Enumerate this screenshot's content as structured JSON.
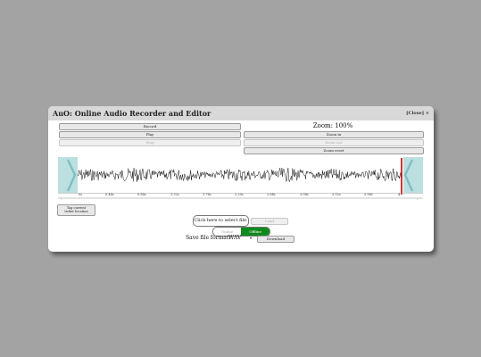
{
  "dialog": {
    "title": "AuO: Online Audio Recorder and Editor",
    "close_label": "[Close] ×"
  },
  "controls": {
    "record": "Record",
    "play": "Play",
    "stop": "Stop",
    "zoom_label": "Zoom: 100%",
    "zoom_in": "Zoom in",
    "zoom_out": "Zoom out",
    "zoom_reset": "Zoom reset"
  },
  "timeline": {
    "ticks": [
      "0s",
      "0.44s",
      "0.88s",
      "1.32s",
      "1.76s",
      "2.20s",
      "2.64s",
      "3.08s",
      "3.52s",
      "3.96s",
      "4"
    ],
    "scroll_left": "‹",
    "scroll_right": "›"
  },
  "tag_button": {
    "line1": "Tag current",
    "line2": "ticker location"
  },
  "file": {
    "select_label": "Click here to select file.",
    "load_label": "Load"
  },
  "mode": {
    "off_label": "Online",
    "on_label": "Offline"
  },
  "save": {
    "label": "Save file format:",
    "format": "WAV",
    "download_label": "Download"
  },
  "colors": {
    "backdrop": "#a3a3a3",
    "waveform": "#111111",
    "selection_overlay": "#bcdfdf",
    "selection_marker": "#7fbfc2",
    "playhead": "#cc0000",
    "toggle_on": "#0e8a1c"
  }
}
